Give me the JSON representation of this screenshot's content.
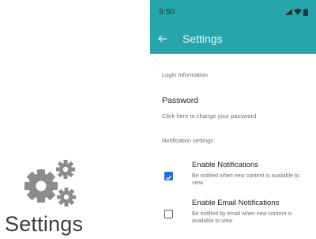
{
  "promo": {
    "title": "Settings",
    "icon": "gears-icon"
  },
  "status_bar": {
    "time": "9:50",
    "icons": [
      "signal-icon",
      "wifi-icon",
      "battery-icon"
    ]
  },
  "app_bar": {
    "title": "Settings",
    "color": "#26a6ab"
  },
  "sections": {
    "login_header": "Login Information",
    "password_title": "Password",
    "password_subtitle": "Click here to change your password",
    "notifications_header": "Notification settings"
  },
  "preferences": [
    {
      "title": "Enable Notifications",
      "description": "Be notified when new content is available to view",
      "checked": true
    },
    {
      "title": "Enable Email Notifications",
      "description": "Be notified by email when new content is available to view",
      "checked": false
    }
  ],
  "colors": {
    "accent": "#26a6ab",
    "checkbox_checked": "#1e6fd6"
  }
}
